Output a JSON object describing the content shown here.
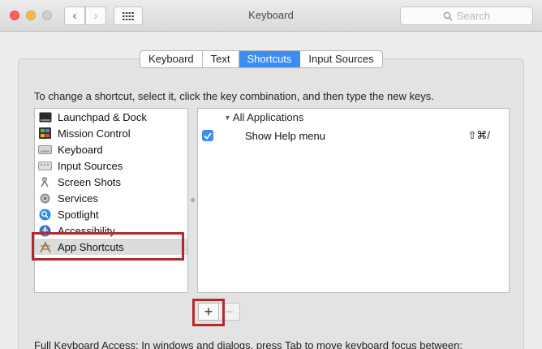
{
  "window": {
    "title": "Keyboard"
  },
  "search": {
    "placeholder": "Search"
  },
  "tabs": [
    {
      "label": "Keyboard",
      "active": false
    },
    {
      "label": "Text",
      "active": false
    },
    {
      "label": "Shortcuts",
      "active": true
    },
    {
      "label": "Input Sources",
      "active": false
    }
  ],
  "instruction": "To change a shortcut, select it, click the key combination, and then type the new keys.",
  "categories": [
    {
      "label": "Launchpad & Dock",
      "icon": "launchpad-dock-icon"
    },
    {
      "label": "Mission Control",
      "icon": "mission-control-icon"
    },
    {
      "label": "Keyboard",
      "icon": "keyboard-icon"
    },
    {
      "label": "Input Sources",
      "icon": "input-sources-icon"
    },
    {
      "label": "Screen Shots",
      "icon": "screenshot-icon"
    },
    {
      "label": "Services",
      "icon": "gear-icon"
    },
    {
      "label": "Spotlight",
      "icon": "spotlight-icon"
    },
    {
      "label": "Accessibility",
      "icon": "accessibility-icon"
    },
    {
      "label": "App Shortcuts",
      "icon": "app-shortcuts-icon",
      "selected": true
    }
  ],
  "shortcuts": {
    "group_label": "All Applications",
    "items": [
      {
        "name": "Show Help menu",
        "keys": "⇧⌘/",
        "enabled": true
      }
    ]
  },
  "buttons": {
    "add": "+",
    "remove": "−"
  },
  "footer": "Full Keyboard Access: In windows and dialogs, press Tab to move keyboard focus between:",
  "colors": {
    "accent": "#3b8df2",
    "highlight_box": "#b02a2a"
  }
}
